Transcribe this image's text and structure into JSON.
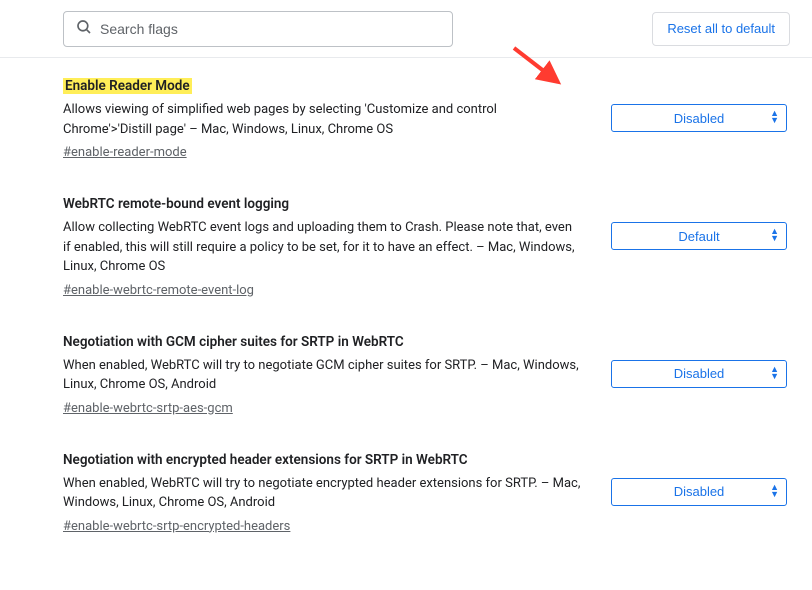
{
  "search": {
    "placeholder": "Search flags"
  },
  "reset_button": "Reset all to default",
  "flags": [
    {
      "title": "Enable Reader Mode",
      "highlighted": true,
      "description": "Allows viewing of simplified web pages by selecting 'Customize and control Chrome'>'Distill page' – Mac, Windows, Linux, Chrome OS",
      "hash": "#enable-reader-mode",
      "value": "Disabled"
    },
    {
      "title": "WebRTC remote-bound event logging",
      "highlighted": false,
      "description": "Allow collecting WebRTC event logs and uploading them to Crash. Please note that, even if enabled, this will still require a policy to be set, for it to have an effect. – Mac, Windows, Linux, Chrome OS",
      "hash": "#enable-webrtc-remote-event-log",
      "value": "Default"
    },
    {
      "title": "Negotiation with GCM cipher suites for SRTP in WebRTC",
      "highlighted": false,
      "description": "When enabled, WebRTC will try to negotiate GCM cipher suites for SRTP. – Mac, Windows, Linux, Chrome OS, Android",
      "hash": "#enable-webrtc-srtp-aes-gcm",
      "value": "Disabled"
    },
    {
      "title": "Negotiation with encrypted header extensions for SRTP in WebRTC",
      "highlighted": false,
      "description": "When enabled, WebRTC will try to negotiate encrypted header extensions for SRTP. – Mac, Windows, Linux, Chrome OS, Android",
      "hash": "#enable-webrtc-srtp-encrypted-headers",
      "value": "Disabled"
    }
  ]
}
